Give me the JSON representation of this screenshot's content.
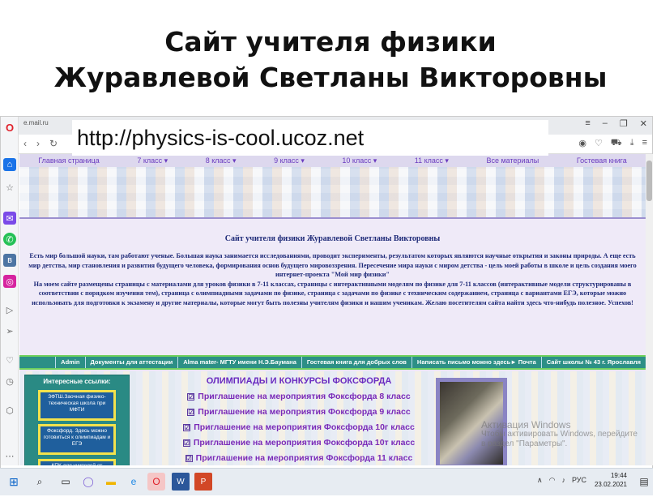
{
  "slide": {
    "title_line1": "Сайт учителя физики",
    "title_line2": "Журавлевой Светланы Викторовны"
  },
  "browser": {
    "tab_title": "e.mail.ru",
    "url_overlay": "http://physics-is-cool.ucoz.net",
    "window_controls": [
      "≡",
      "–",
      "❐",
      "✕"
    ],
    "nav_icons": [
      "‹",
      "›",
      "↻"
    ]
  },
  "site": {
    "nav": [
      "Главная страница",
      "7 класс ▾",
      "8 класс ▾",
      "9 класс ▾",
      "10 класс ▾",
      "11 класс ▾",
      "Все материалы",
      "Гостевая книга"
    ],
    "intro_title": "Сайт учителя физики Журавлевой Светланы Викторовны",
    "intro_text": "Есть мир большой науки, там работают ученые. Большая наука занимается исследованиями, проводит эксперименты, результатом которых являются научные открытия и законы природы. А еще есть мир детства, мир становления и развития будущего человека, формирования основ будущего мировоззрения. Пересечение мира науки с миром детства - цель моей работы в школе и цель создания моего интернет-проекта \"Мой мир физики\"",
    "intro_text2": "На моем сайте размещены страницы с материалами для уроков физики в 7-11 классах, страницы с интерактивными моделям по физике для 7-11 классов (интерактивные модели структурированы в соответствии с порядком изучения тем), страница с олимпиадными задачами по физике, страница с задачами по физике с техническим содержанием, страница с вариантами ЕГЭ, которые можно использовать для подготовки к экзамену и другие материалы, которые могут быть полезны учителям физики и нашим ученикам. Желаю посетителям сайта найти здесь что-нибудь полезное. Успехов!",
    "links_bar": [
      "Admin",
      "Документы для аттестации",
      "Alma mater- МГТУ имени Н.Э.Баумана",
      "Гостевая книга для добрых слов",
      "Написать письмо можно здесь► Почта",
      "Сайт школы № 43 г. Ярославля"
    ],
    "interesting_head": "Интересные ссылки:",
    "interesting_links": [
      "ЗФТШ.Заочная физико-техническая школа при МФТИ",
      "Фоксфорд. Здесь можно готовиться к олимпиадам и ЕГЭ",
      "КПК для учителей от Центра онлайн обучения Фоксфорд"
    ],
    "olymp_title": "ОЛИМПИАДЫ И КОНКУРСЫ ФОКСФОРДА",
    "olymp_items": [
      "Приглашение на мероприятия Фоксфорда 8 класс",
      "Приглашение на мероприятия Фоксфорда 9 класс",
      "Приглашение на мероприятия Фоксфорда 10г класс",
      "Приглашение на мероприятия Фоксфорда 10т класс",
      "Приглашение на мероприятия Фоксфорда 11 класс"
    ],
    "check_glyph": "☑"
  },
  "os": {
    "watermark_line1": "Активация Windows",
    "watermark_line2": "Чтобы активировать Windows, перейдите",
    "watermark_line3": "в раздел \"Параметры\".",
    "clock_time": "19:44",
    "clock_date": "23.02.2021",
    "lang": "РУС"
  },
  "colors": {
    "accent": "#6a2bc0",
    "linkbar": "#2c8f86",
    "opera_red": "#e0202a"
  }
}
